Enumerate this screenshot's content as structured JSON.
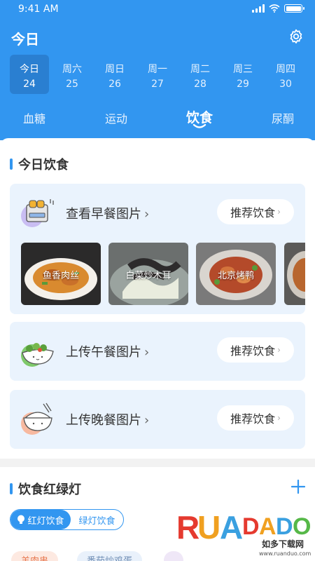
{
  "status": {
    "time": "9:41 AM"
  },
  "header": {
    "title": "今日"
  },
  "week": [
    {
      "weekday": "今日",
      "day": "24",
      "active": true
    },
    {
      "weekday": "周六",
      "day": "25"
    },
    {
      "weekday": "周日",
      "day": "26"
    },
    {
      "weekday": "周一",
      "day": "27"
    },
    {
      "weekday": "周二",
      "day": "28"
    },
    {
      "weekday": "周三",
      "day": "29"
    },
    {
      "weekday": "周四",
      "day": "30"
    }
  ],
  "tabs": [
    "血糖",
    "运动",
    "饮食",
    "尿酮"
  ],
  "active_tab": "饮食",
  "today_diet": {
    "title": "今日饮食",
    "breakfast": {
      "label": "查看早餐图片",
      "recommend": "推荐饮食",
      "photos": [
        "鱼香肉丝",
        "白菜炒木耳",
        "北京烤鸭"
      ]
    },
    "lunch": {
      "label": "上传午餐图片",
      "recommend": "推荐饮食"
    },
    "dinner": {
      "label": "上传晚餐图片",
      "recommend": "推荐饮食"
    }
  },
  "traffic_light": {
    "title": "饮食红绿灯",
    "toggle_on": "红灯饮食",
    "toggle_off": "绿灯饮食",
    "chips": [
      "羊肉串",
      "番茄炒鸡蛋"
    ]
  },
  "watermark": {
    "brand": "RUANDADO",
    "sub": "如多下载网",
    "url": "www.ruanduo.com"
  },
  "colors": {
    "primary": "#3296f0",
    "card": "#eaf3fd"
  }
}
